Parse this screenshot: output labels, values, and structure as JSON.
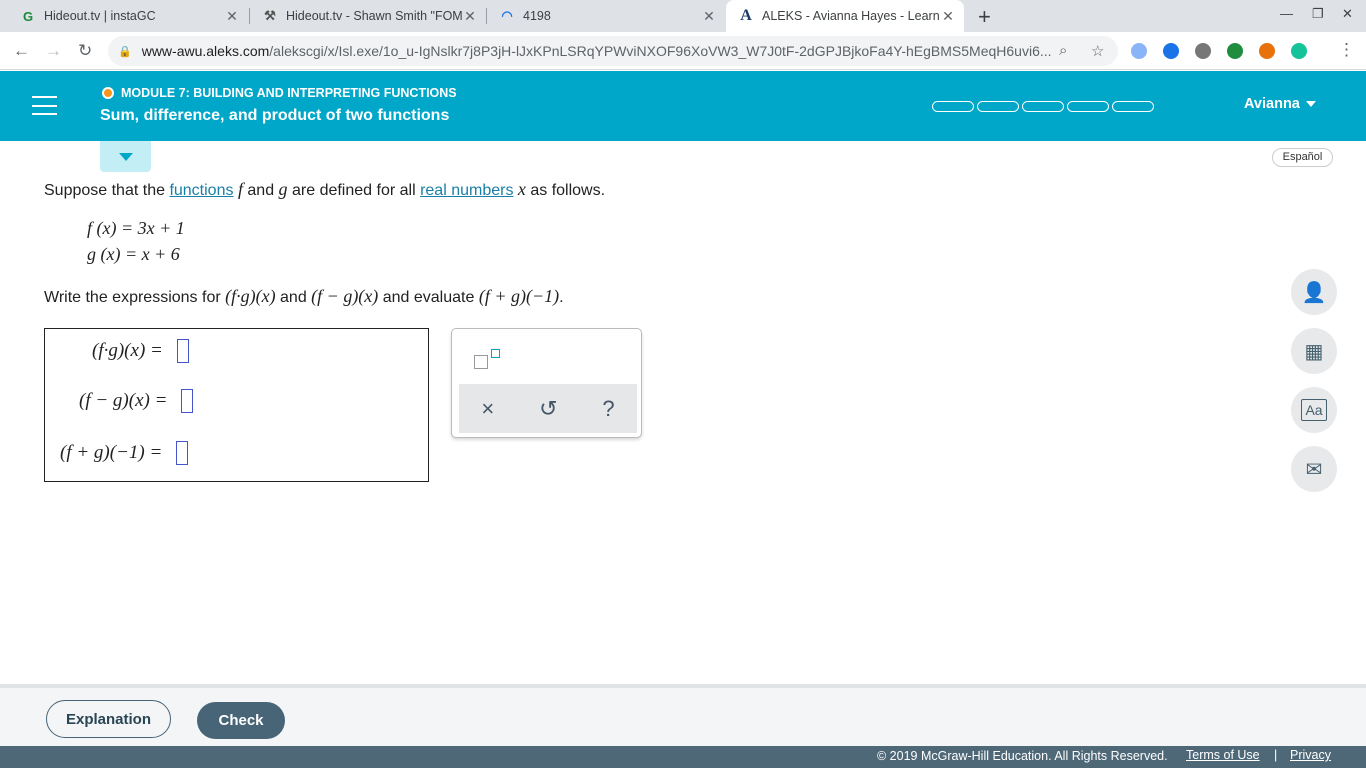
{
  "browser": {
    "tabs": [
      {
        "title": "Hideout.tv | instaGC",
        "favicon": "G"
      },
      {
        "title": "Hideout.tv - Shawn Smith \"FOMO\"",
        "favicon": "⚒"
      },
      {
        "title": "4198",
        "favicon": "◠"
      },
      {
        "title": "ALEKS - Avianna Hayes - Learn",
        "favicon": "A"
      }
    ],
    "url_domain": "www-awu.aleks.com",
    "url_path": "/alekscgi/x/Isl.exe/1o_u-IgNslkr7j8P3jH-lJxKPnLSRqYPWviNXOF96XoVW3_W7J0tF-2dGPJBjkoFa4Y-hEgBMS5MeqH6uvi6..."
  },
  "header": {
    "module": "MODULE 7: BUILDING AND INTERPRETING FUNCTIONS",
    "topic": "Sum, difference, and product of two functions",
    "user": "Avianna"
  },
  "espanol": "Español",
  "problem": {
    "intro_1": "Suppose that the ",
    "link_functions": "functions",
    "intro_2": " and ",
    "intro_3": " are defined for all ",
    "link_real": "real numbers",
    "intro_4": " as follows.",
    "f_def": "f (x) = 3x + 1",
    "g_def": "g (x) = x + 6",
    "prompt_1": "Write the expressions for ",
    "prompt_2": " and ",
    "prompt_3": " and evaluate ",
    "expr_prod": "(f·g)(x)",
    "expr_diff": "(f − g)(x)",
    "expr_sum": "(f + g)(−1)"
  },
  "answers": {
    "row1_label": "(f·g)(x) =",
    "row2_label": "(f − g)(x) =",
    "row3_label": "(f + g)(−1) ="
  },
  "keypad": {
    "clear": "×",
    "undo": "↺",
    "help": "?"
  },
  "buttons": {
    "explanation": "Explanation",
    "check": "Check"
  },
  "footer": {
    "copyright": "© 2019 McGraw-Hill Education. All Rights Reserved.",
    "terms": "Terms of Use",
    "separator": "|",
    "privacy": "Privacy"
  }
}
